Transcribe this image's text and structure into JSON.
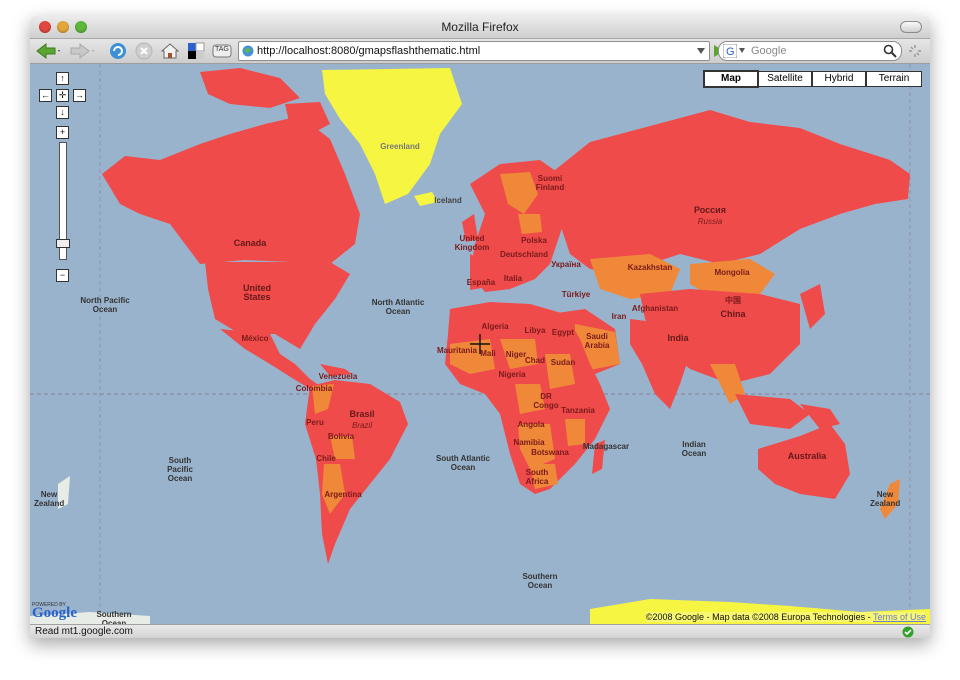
{
  "window": {
    "title": "Mozilla Firefox"
  },
  "toolbar": {
    "url": "http://localhost:8080/gmapsflashthematic.html",
    "search_placeholder": "Google",
    "tag_label": "TAG"
  },
  "map": {
    "types": [
      {
        "label": "Map",
        "selected": true
      },
      {
        "label": "Satellite",
        "selected": false
      },
      {
        "label": "Hybrid",
        "selected": false
      },
      {
        "label": "Terrain",
        "selected": false
      }
    ],
    "labels": {
      "greenland": "Greenland",
      "iceland": "Iceland",
      "canada": "Canada",
      "united_states": "United States",
      "mexico": "México",
      "north_pacific": "North Pacific Ocean",
      "north_atlantic": "North Atlantic Ocean",
      "south_pacific": "South Pacific Ocean",
      "south_atlantic": "South Atlantic Ocean",
      "indian_ocean": "Indian Ocean",
      "southern_ocean_1": "Southern Ocean",
      "southern_ocean_2": "Southern Ocean",
      "russia_native": "Россия",
      "russia": "Russia",
      "kazakhstan": "Kazakhstan",
      "mongolia": "Mongolia",
      "china_native": "中国",
      "china": "China",
      "india": "India",
      "iran": "Iran",
      "afghanistan": "Afghanistan",
      "turkey": "Türkiye",
      "ukraine": "Україна",
      "algeria": "Algeria",
      "libya": "Libya",
      "egypt": "Egypt",
      "saudi": "Saudi Arabia",
      "mauritania": "Mauritania",
      "mali": "Mali",
      "niger": "Niger",
      "chad": "Chad",
      "sudan": "Sudan",
      "nigeria": "Nigeria",
      "drc": "DR Congo",
      "tanzania": "Tanzania",
      "angola": "Angola",
      "namibia": "Namibia",
      "botswana": "Botswana",
      "madagascar": "Madagascar",
      "south_africa": "South Africa",
      "venezuela": "Venezuela",
      "colombia": "Colombia",
      "peru": "Peru",
      "brasil": "Brasil",
      "brazil": "Brazil",
      "bolivia": "Bolivia",
      "chile": "Chile",
      "argentina": "Argentina",
      "australia": "Australia",
      "new_zealand_w": "New Zealand",
      "new_zealand_e": "New Zealand",
      "finland": "Suomi Finland",
      "uk": "United Kingdom",
      "poland": "Polska",
      "deutschland": "Deutschland",
      "espana": "España",
      "italia": "Italia"
    },
    "powered_by": "POWERED BY",
    "google_logo": "Google",
    "copyright_text": "©2008 Google - Map data ©2008  Europa Technologies - ",
    "terms_link": "Terms of Use",
    "colors": {
      "ocean": "#99b3cc",
      "high": "#f04b4b",
      "medium": "#f0883a",
      "none": "#f5f542"
    }
  },
  "status": {
    "text": "Read mt1.google.com"
  }
}
